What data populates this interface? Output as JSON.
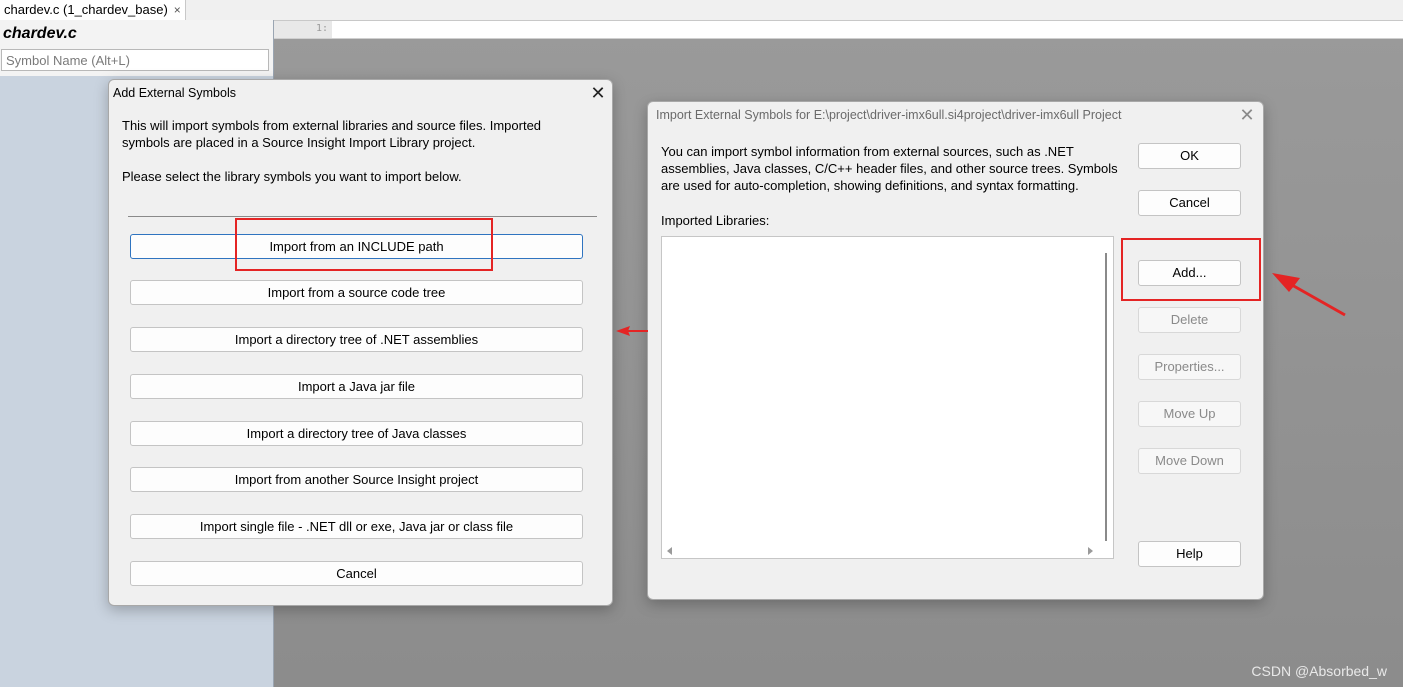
{
  "tab": {
    "label": "chardev.c (1_chardev_base)",
    "close_glyph": "×"
  },
  "symbol_pane": {
    "title": "chardev.c",
    "search_placeholder": "Symbol Name (Alt+L)"
  },
  "editor": {
    "line_number": "1:"
  },
  "add_dialog": {
    "title": "Add External Symbols",
    "close_glyph": "✕",
    "intro_1": "This will import symbols from external libraries and source files. Imported",
    "intro_2": "symbols are placed in a Source Insight Import Library project.",
    "intro_3": "Please select the library symbols you want to import below.",
    "buttons": [
      "Import from an INCLUDE path",
      "Import from a source code tree",
      "Import a directory tree of .NET assemblies",
      "Import a Java jar file",
      "Import a directory tree of Java classes",
      "Import from another Source Insight project",
      "Import single file - .NET dll or exe, Java jar or class file",
      "Cancel"
    ]
  },
  "import_dialog": {
    "title": "Import External Symbols for E:\\project\\driver-imx6ull.si4project\\driver-imx6ull Project",
    "close_glyph": "✕",
    "desc_1": "You can import symbol information from external sources, such as .NET",
    "desc_2": "assemblies, Java classes, C/C++ header files, and other source trees. Symbols",
    "desc_3": "are used for auto-completion, showing definitions, and syntax formatting.",
    "list_label": "Imported Libraries:",
    "buttons": {
      "ok": "OK",
      "cancel": "Cancel",
      "add": "Add...",
      "delete": "Delete",
      "properties": "Properties...",
      "move_up": "Move Up",
      "move_down": "Move Down",
      "help": "Help"
    }
  },
  "watermark": "CSDN @Absorbed_w",
  "colors": {
    "annotation": "#e42424",
    "focus_border": "#2f74c0"
  }
}
